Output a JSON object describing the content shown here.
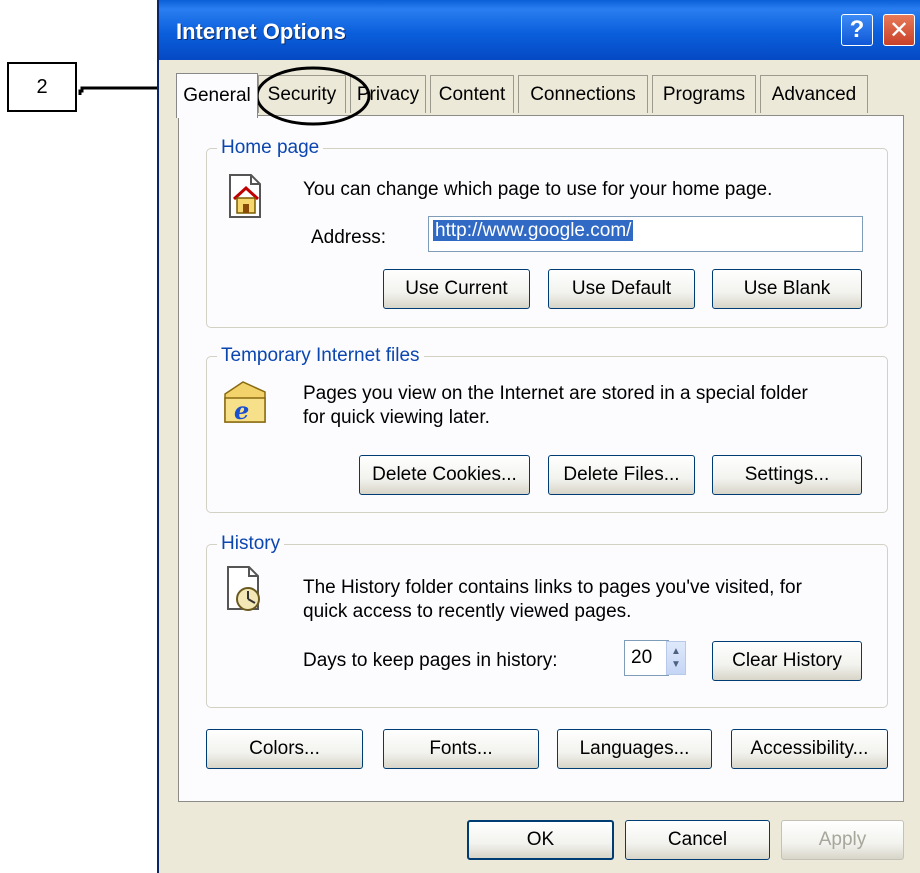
{
  "annotation": {
    "step_number": "2"
  },
  "window": {
    "title": "Internet Options",
    "help_glyph": "?",
    "close_glyph": "✕"
  },
  "tabs": [
    {
      "label": "General",
      "active": true
    },
    {
      "label": "Security"
    },
    {
      "label": "Privacy"
    },
    {
      "label": "Content"
    },
    {
      "label": "Connections"
    },
    {
      "label": "Programs"
    },
    {
      "label": "Advanced"
    }
  ],
  "home_page": {
    "group_label": "Home page",
    "description": "You can change which page to use for your home page.",
    "address_label": "Address:",
    "address_value": "http://www.google.com/",
    "buttons": [
      "Use Current",
      "Use Default",
      "Use Blank"
    ]
  },
  "temp_files": {
    "group_label": "Temporary Internet files",
    "description_line1": "Pages you view on the Internet are stored in a special folder",
    "description_line2": "for quick viewing later.",
    "buttons": [
      "Delete Cookies...",
      "Delete Files...",
      "Settings..."
    ]
  },
  "history": {
    "group_label": "History",
    "description_line1": "The History folder contains links to pages you've visited, for",
    "description_line2": "quick access to recently viewed pages.",
    "days_label": "Days to keep pages in history:",
    "days_value": "20",
    "clear_button": "Clear History"
  },
  "bottom_buttons": [
    "Colors...",
    "Fonts...",
    "Languages...",
    "Accessibility..."
  ],
  "dialog_buttons": {
    "ok": "OK",
    "cancel": "Cancel",
    "apply": "Apply"
  },
  "colors": {
    "title_bar": "#0b5fdc",
    "group_label": "#0b46b0",
    "annotation": "#000000"
  },
  "icons": {
    "home": "home-page-icon",
    "temp_files": "ie-folder-icon",
    "history": "history-clock-icon"
  }
}
